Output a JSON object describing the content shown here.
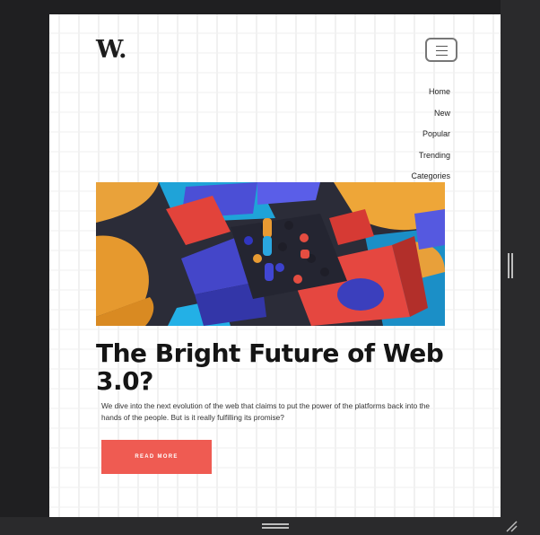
{
  "site": {
    "logo": "W.",
    "menu_icon": "hamburger-icon"
  },
  "nav": {
    "items": [
      "Home",
      "New",
      "Popular",
      "Trending",
      "Categories"
    ]
  },
  "article": {
    "image_alt": "colorful 3D abstract blocks",
    "title": "The Bright Future of Web 3.0?",
    "excerpt": "We dive into the next evolution of the web that claims to put the power of the platforms back into the hands of the people. But is it really fulfilling its promise?",
    "cta": "Read more"
  },
  "colors": {
    "accent": "#ef5b52",
    "frame": "#1f1f21",
    "text": "#151515"
  }
}
